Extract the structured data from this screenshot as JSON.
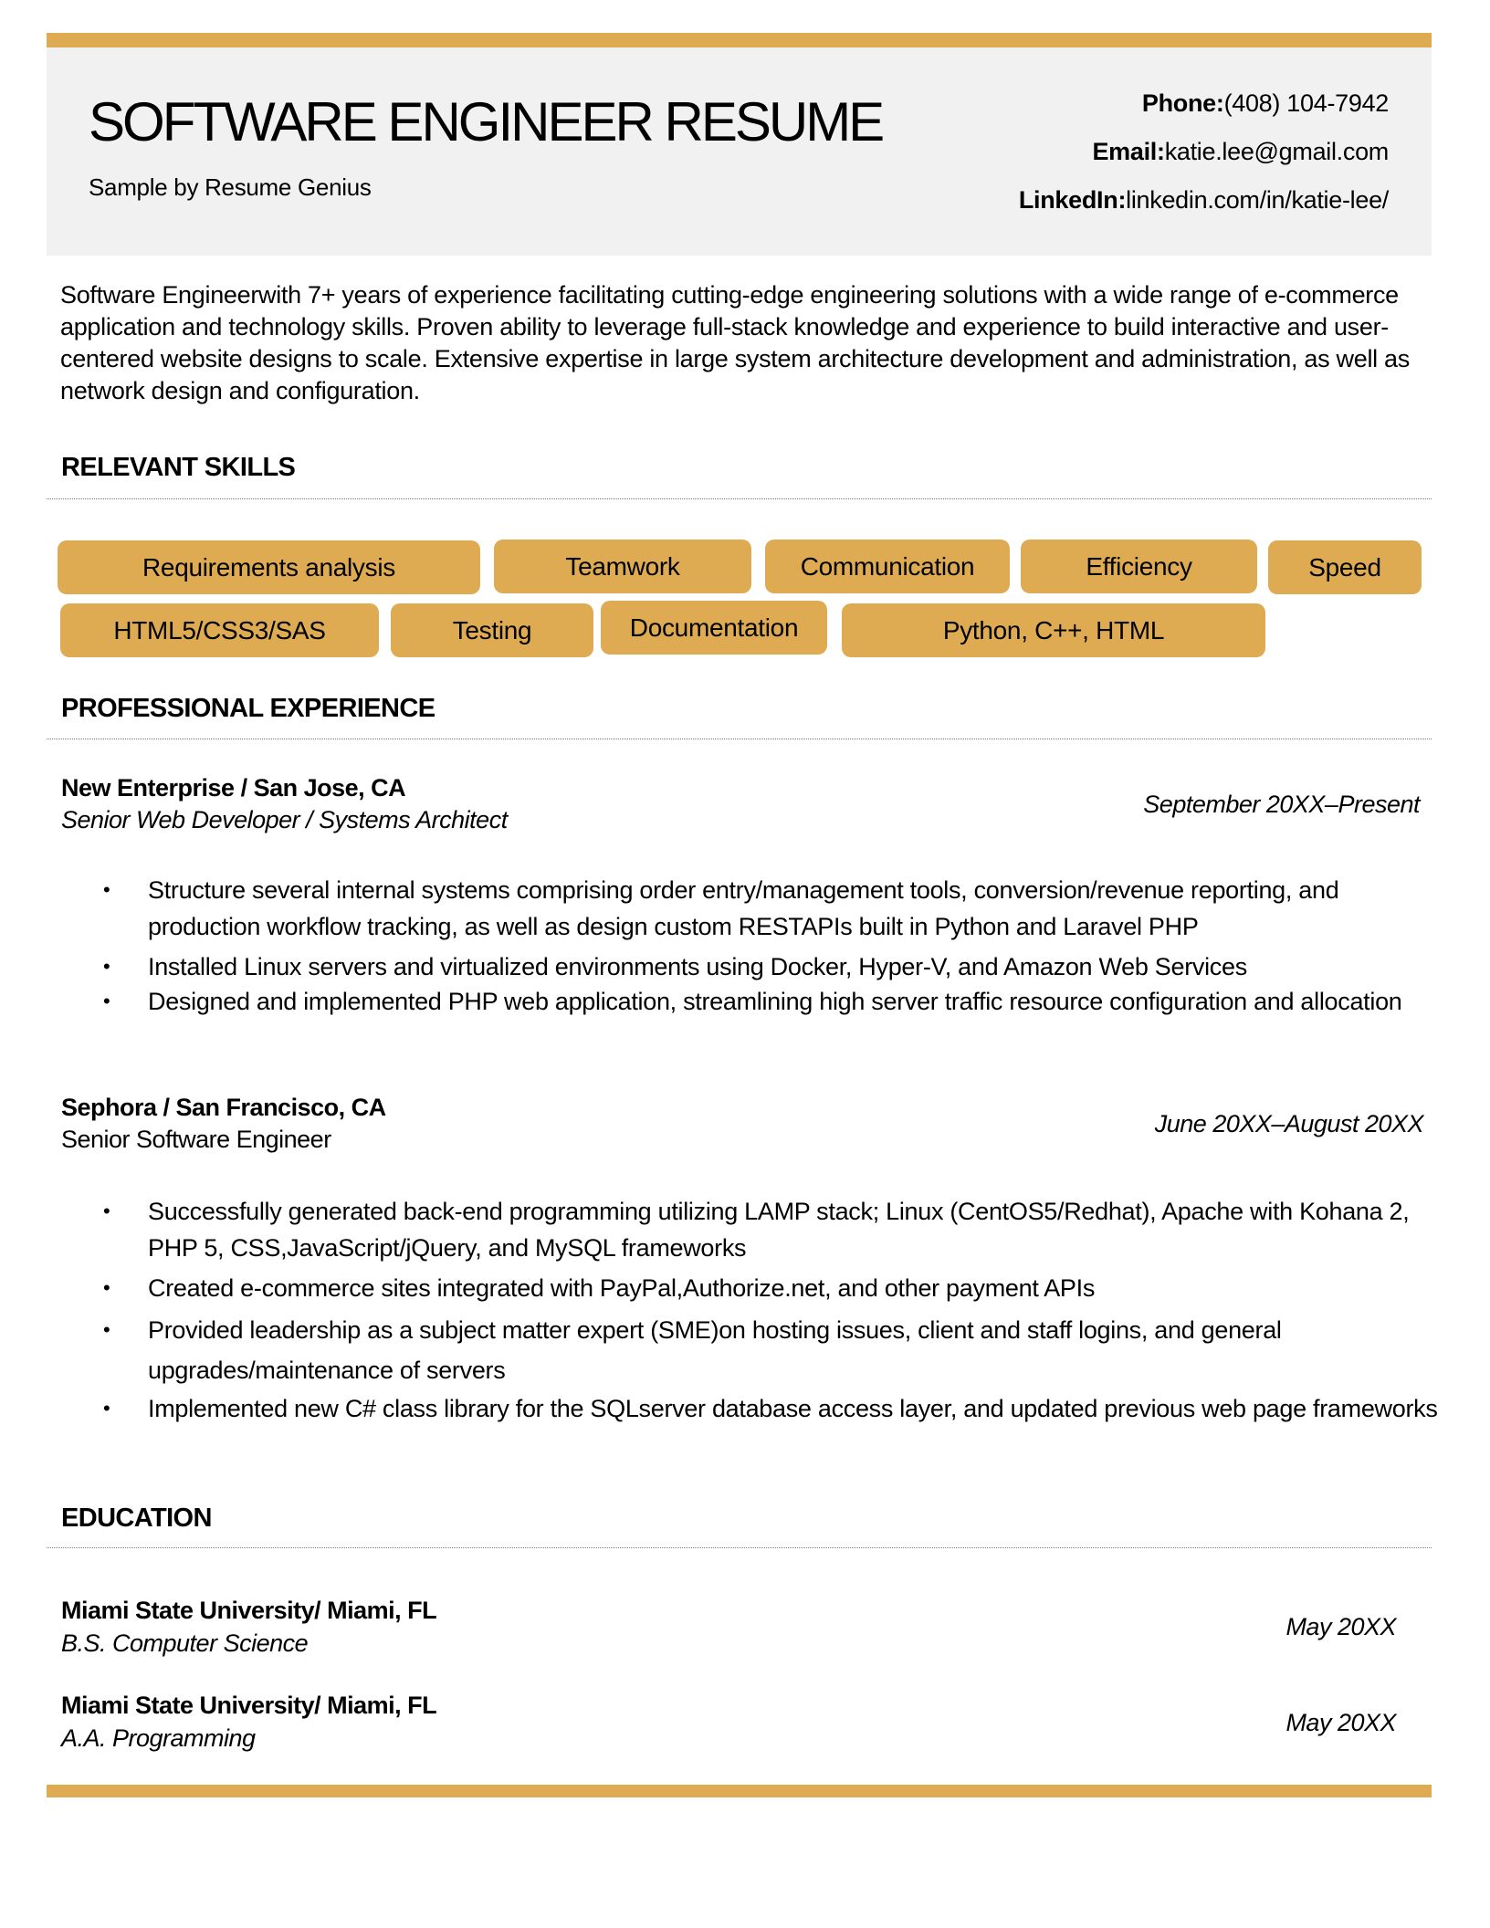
{
  "header": {
    "title": "SOFTWARE ENGINEER RESUME",
    "subtitle": "Sample by Resume Genius",
    "contact": {
      "phone_label": "Phone:",
      "phone": "(408) 104-7942",
      "email_label": "Email:",
      "email": "katie.lee@gmail.com",
      "linkedin_label": "LinkedIn:",
      "linkedin": "linkedin.com/in/katie-lee/"
    }
  },
  "summary": "Software Engineerwith 7+ years of experience facilitating  cutting-edge engineering solutions with a wide range of e-commerce application and technology skills. Proven ability to leverage full-stack  knowledge and experience to build interactive and user-centered website designs to scale. Extensive expertise in large system  architecture development and administration, as well as network design and configuration.",
  "skills": {
    "title": "RELEVANT SKILLS",
    "items": [
      "Requirements analysis",
      "Teamwork",
      "Communication",
      "Efficiency",
      "Speed",
      "HTML5/CSS3/SAS",
      "Testing",
      "Documentation",
      "Python, C++, HTML"
    ]
  },
  "experience": {
    "title": "PROFESSIONAL EXPERIENCE",
    "jobs": [
      {
        "company": "New Enterprise / San Jose, CA",
        "role": "Senior Web Developer /  Systems Architect",
        "dates": "September 20XX–Present",
        "bullets": [
          "Structure several internal systems comprising order entry/management tools, conversion/revenue reporting, and production workflow tracking, as well as design custom RESTAPIs built in Python and Laravel PHP",
          "Installed Linux servers and virtualized environments using Docker, Hyper-V, and Amazon Web Services",
          "Designed and implemented PHP web application, streamlining high server traffic  resource configuration  and allocation"
        ]
      },
      {
        "company": "Sephora /  San Francisco, CA",
        "role": "Senior Software  Engineer",
        "dates": "June 20XX–August 20XX",
        "bullets": [
          "Successfully generated back-end programming  utilizing  LAMP stack; Linux (CentOS5/Redhat), Apache with Kohana 2, PHP 5, CSS,JavaScript/jQuery,  and MySQL frameworks",
          "Created e-commerce sites integrated  with  PayPal,Authorize.net, and other payment APIs",
          "Provided leadership as a subject matter expert (SME)on hosting issues, client and staff  logins, and general upgrades/maintenance  of servers",
          "Implemented  new C# class library for the SQLserver database access layer, and updated previous web page frameworks"
        ]
      }
    ]
  },
  "education": {
    "title": "EDUCATION",
    "entries": [
      {
        "school": "Miami  State University/  Miami,  FL",
        "degree": "B.S. Computer Science",
        "date": "May 20XX"
      },
      {
        "school": "Miami  State University/  Miami,  FL",
        "degree": "A.A. Programming",
        "date": "May 20XX"
      }
    ]
  },
  "colors": {
    "accent": "#DFAB52",
    "header_bg": "#F1F1F1",
    "divider": "#7A7A7A"
  }
}
